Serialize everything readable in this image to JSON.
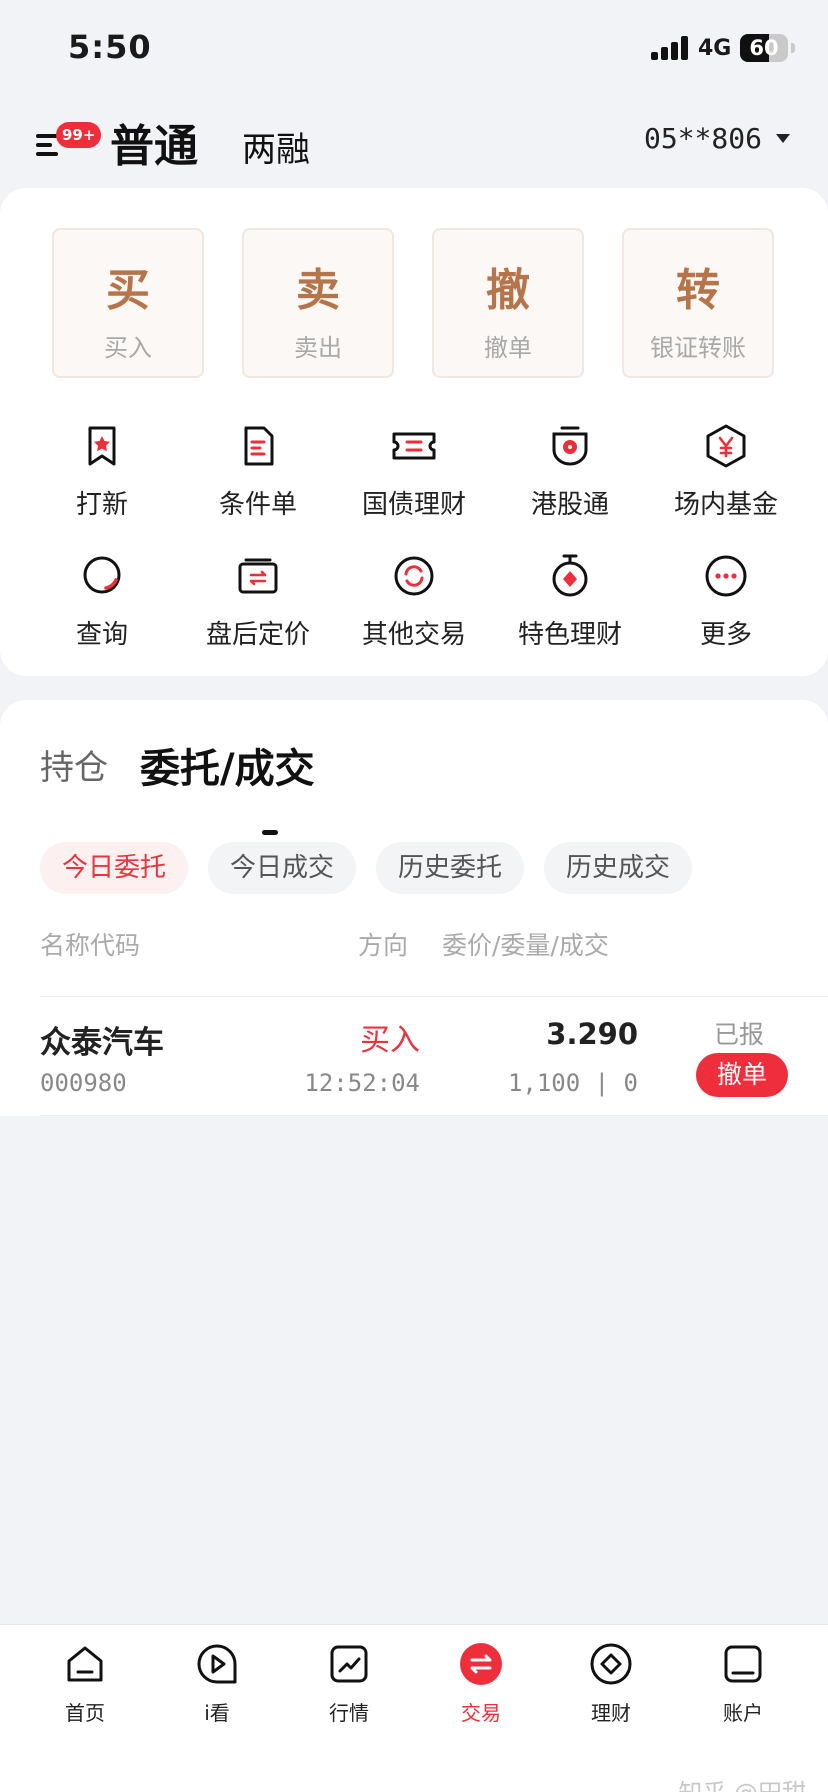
{
  "status_bar": {
    "time": "5:50",
    "network": "4G",
    "battery": "60",
    "battery_level": 0.6
  },
  "header": {
    "badge": "99+",
    "tab_normal": "普通",
    "tab_margin": "两融",
    "account": "05**806"
  },
  "quick_actions": [
    {
      "glyph": "买",
      "label": "买入"
    },
    {
      "glyph": "卖",
      "label": "卖出"
    },
    {
      "glyph": "撤",
      "label": "撤单"
    },
    {
      "glyph": "转",
      "label": "银证转账"
    }
  ],
  "functions": [
    {
      "label": "打新",
      "icon": "bookmark-star-icon"
    },
    {
      "label": "条件单",
      "icon": "document-lines-icon"
    },
    {
      "label": "国债理财",
      "icon": "ticket-icon"
    },
    {
      "label": "港股通",
      "icon": "hk-flower-icon"
    },
    {
      "label": "场内基金",
      "icon": "yen-hexagon-icon"
    },
    {
      "label": "查询",
      "icon": "search-query-icon"
    },
    {
      "label": "盘后定价",
      "icon": "exchange-box-icon"
    },
    {
      "label": "其他交易",
      "icon": "refresh-circle-icon"
    },
    {
      "label": "特色理财",
      "icon": "stopwatch-gem-icon"
    },
    {
      "label": "更多",
      "icon": "more-dots-icon"
    }
  ],
  "orders_section": {
    "tab_position": "持仓",
    "tab_orders": "委托/成交",
    "chips": [
      "今日委托",
      "今日成交",
      "历史委托",
      "历史成交"
    ],
    "columns": [
      "名称代码",
      "方向",
      "委价/委量/成交"
    ],
    "rows": [
      {
        "name": "众泰汽车",
        "code": "000980",
        "direction": "买入",
        "time": "12:52:04",
        "price": "3.290",
        "qty": "1,100 | 0",
        "status": "已报",
        "action": "撤单"
      }
    ]
  },
  "bottom_nav": [
    {
      "label": "首页",
      "icon": "home-icon"
    },
    {
      "label": "i看",
      "icon": "play-circle-icon"
    },
    {
      "label": "行情",
      "icon": "trend-chart-icon"
    },
    {
      "label": "交易",
      "icon": "exchange-icon",
      "active": true
    },
    {
      "label": "理财",
      "icon": "diamond-circle-icon"
    },
    {
      "label": "账户",
      "icon": "account-icon"
    }
  ],
  "watermark": "知乎 @田甜",
  "colors": {
    "accent": "#ee2f3b",
    "gold": "#b5744a"
  }
}
